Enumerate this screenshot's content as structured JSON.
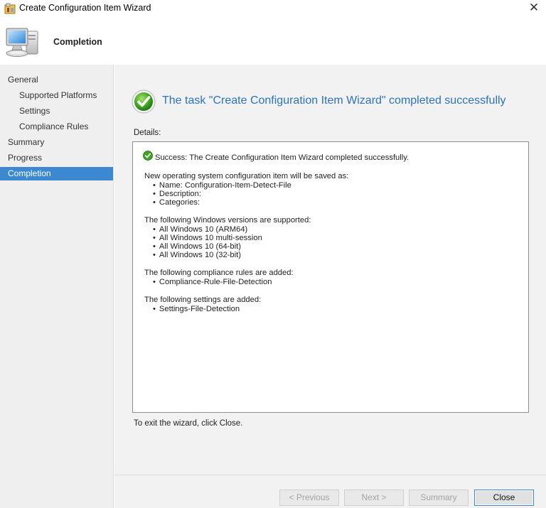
{
  "window": {
    "title": "Create Configuration Item Wizard",
    "close_glyph": "✕"
  },
  "header": {
    "page_title": "Completion",
    "icon": "computer-monitor-icon"
  },
  "sidebar": {
    "items": [
      {
        "label": "General",
        "level": 0,
        "active": false
      },
      {
        "label": "Supported Platforms",
        "level": 1,
        "active": false
      },
      {
        "label": "Settings",
        "level": 1,
        "active": false
      },
      {
        "label": "Compliance Rules",
        "level": 1,
        "active": false
      },
      {
        "label": "Summary",
        "level": 0,
        "active": false
      },
      {
        "label": "Progress",
        "level": 0,
        "active": false
      },
      {
        "label": "Completion",
        "level": 0,
        "active": true
      }
    ],
    "active_color": "#3c89d2"
  },
  "main": {
    "task_title": "The task \"Create Configuration Item Wizard\" completed successfully",
    "details_label": "Details:",
    "details": {
      "success_line": "Success: The Create Configuration Item Wizard completed successfully.",
      "saved_as_heading": "New operating system configuration item will be saved as:",
      "saved_as_items": [
        "Name: Configuration-Item-Detect-File",
        "Description:",
        "Categories:"
      ],
      "windows_heading": "The following Windows versions are supported:",
      "windows_items": [
        "All Windows 10 (ARM64)",
        "All Windows 10 multi-session",
        "All Windows 10 (64-bit)",
        "All Windows 10 (32-bit)"
      ],
      "rules_heading": "The following compliance rules are added:",
      "rules_items": [
        "Compliance-Rule-File-Detection"
      ],
      "settings_heading": "The following settings are added:",
      "settings_items": [
        "Settings-File-Detection"
      ]
    },
    "exit_hint": "To exit the wizard, click Close.",
    "title_color": "#2a73c2"
  },
  "footer": {
    "previous_label": "< Previous",
    "next_label": "Next >",
    "summary_label": "Summary",
    "close_label": "Close"
  }
}
